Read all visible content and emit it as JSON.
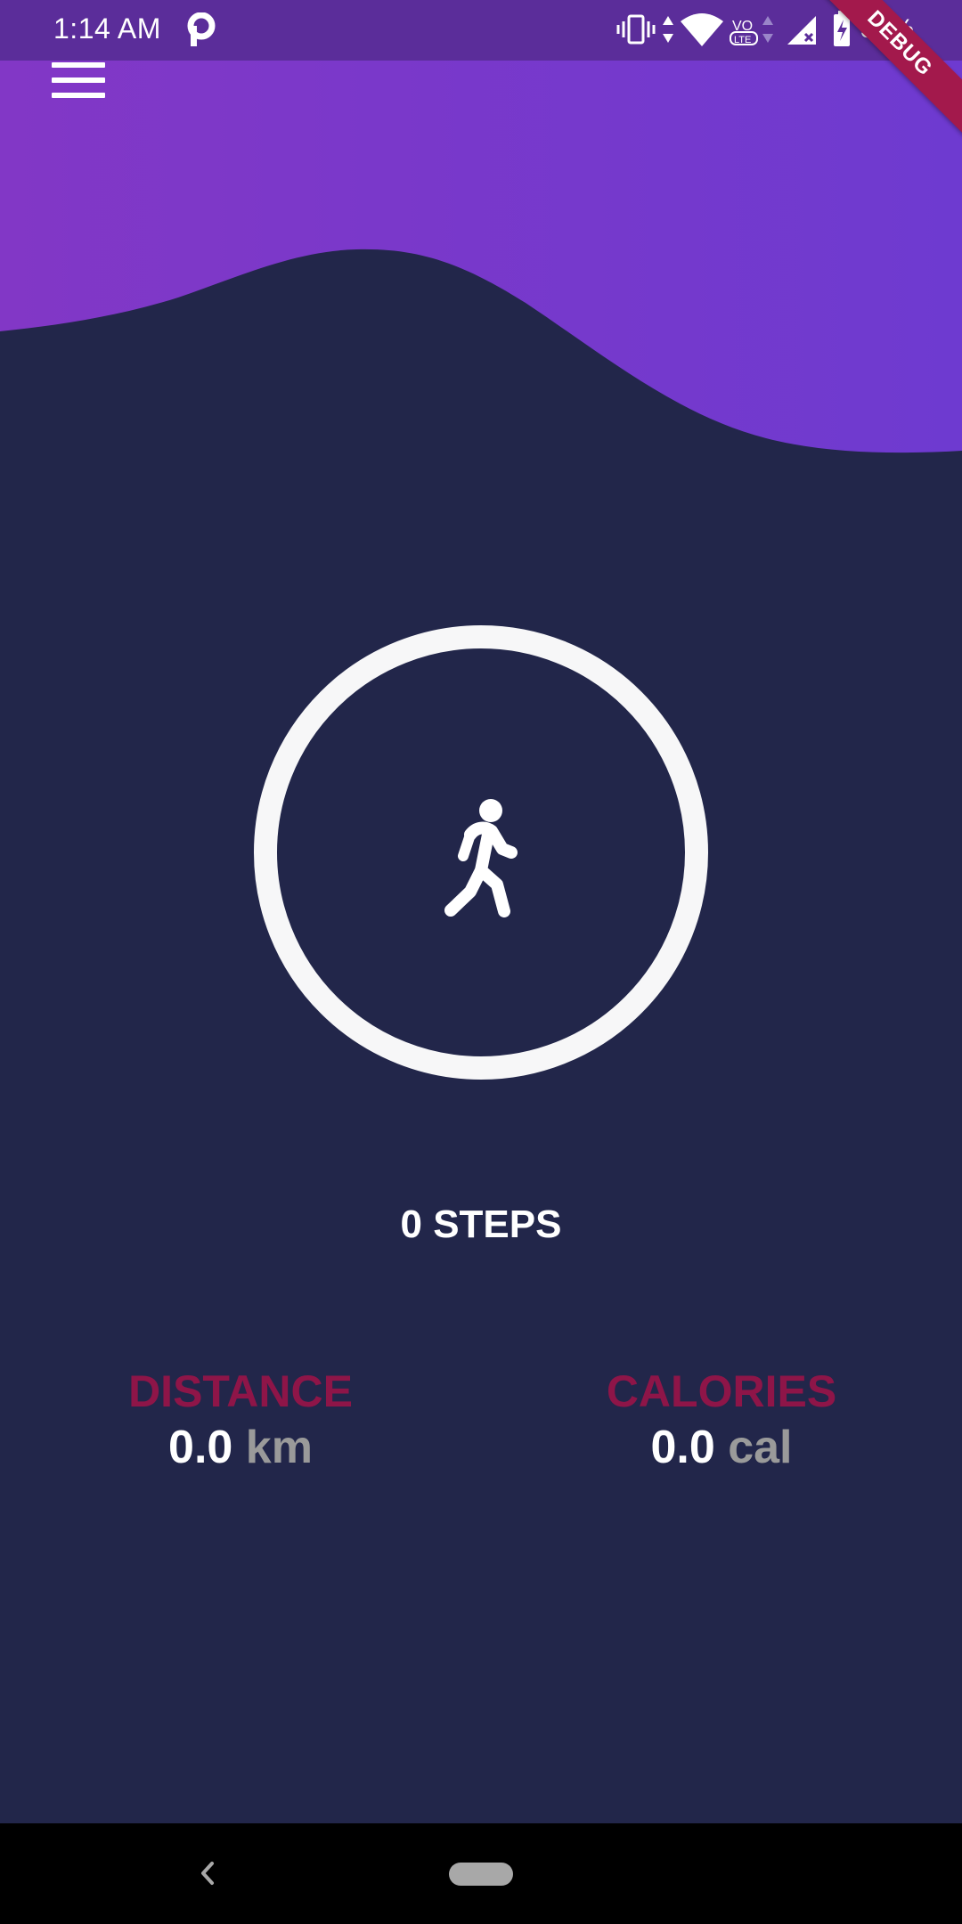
{
  "status_bar": {
    "time": "1:14 AM",
    "battery": "32%"
  },
  "debug_banner": "DEBUG",
  "main": {
    "steps_label": "0 STEPS",
    "distance": {
      "label": "DISTANCE",
      "value": "0.0",
      "unit": "km"
    },
    "calories": {
      "label": "CALORIES",
      "value": "0.0",
      "unit": "cal"
    }
  },
  "colors": {
    "background": "#22264a",
    "header_purple": "#7b3ac9",
    "stat_label": "#8e1548",
    "ring": "#f7f7f8"
  },
  "icons": {
    "menu": "menu-icon",
    "walk": "walking-person-icon",
    "back": "back-icon",
    "home": "home-pill-icon"
  }
}
